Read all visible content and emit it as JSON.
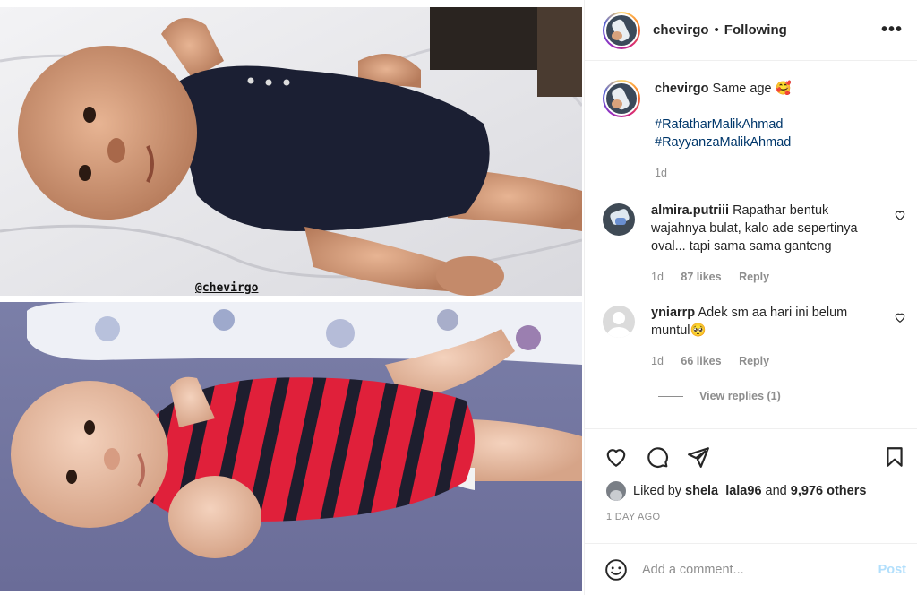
{
  "media": {
    "watermark": "@chevirgo"
  },
  "header": {
    "username": "chevirgo",
    "separator": "•",
    "follow_status": "Following",
    "more_icon": "more-horizontal-icon"
  },
  "caption": {
    "username": "chevirgo",
    "text": "Same age 🥰",
    "hashtags": [
      "#RafatharMalikAhmad",
      "#RayyanzaMalikAhmad"
    ],
    "time": "1d"
  },
  "comments": [
    {
      "username": "almira.putriii",
      "text": "Rapathar bentuk wajahnya bulat, kalo ade sepertinya oval... tapi sama sama ganteng",
      "time": "1d",
      "likes": "87 likes",
      "reply": "Reply"
    },
    {
      "username": "yniarrp",
      "text": "Adek sm aa hari ini belum muntul🥺",
      "time": "1d",
      "likes": "66 likes",
      "reply": "Reply",
      "view_replies": "View replies (1)"
    }
  ],
  "actions": {
    "icons": [
      "heart-icon",
      "comment-icon",
      "share-icon",
      "bookmark-icon"
    ],
    "liked_by_prefix": "Liked by",
    "liked_by_user": "shela_lala96",
    "liked_by_and": "and",
    "liked_by_others": "9,976 others",
    "time_ago": "1 DAY AGO"
  },
  "add_comment": {
    "placeholder": "Add a comment...",
    "post_label": "Post"
  }
}
